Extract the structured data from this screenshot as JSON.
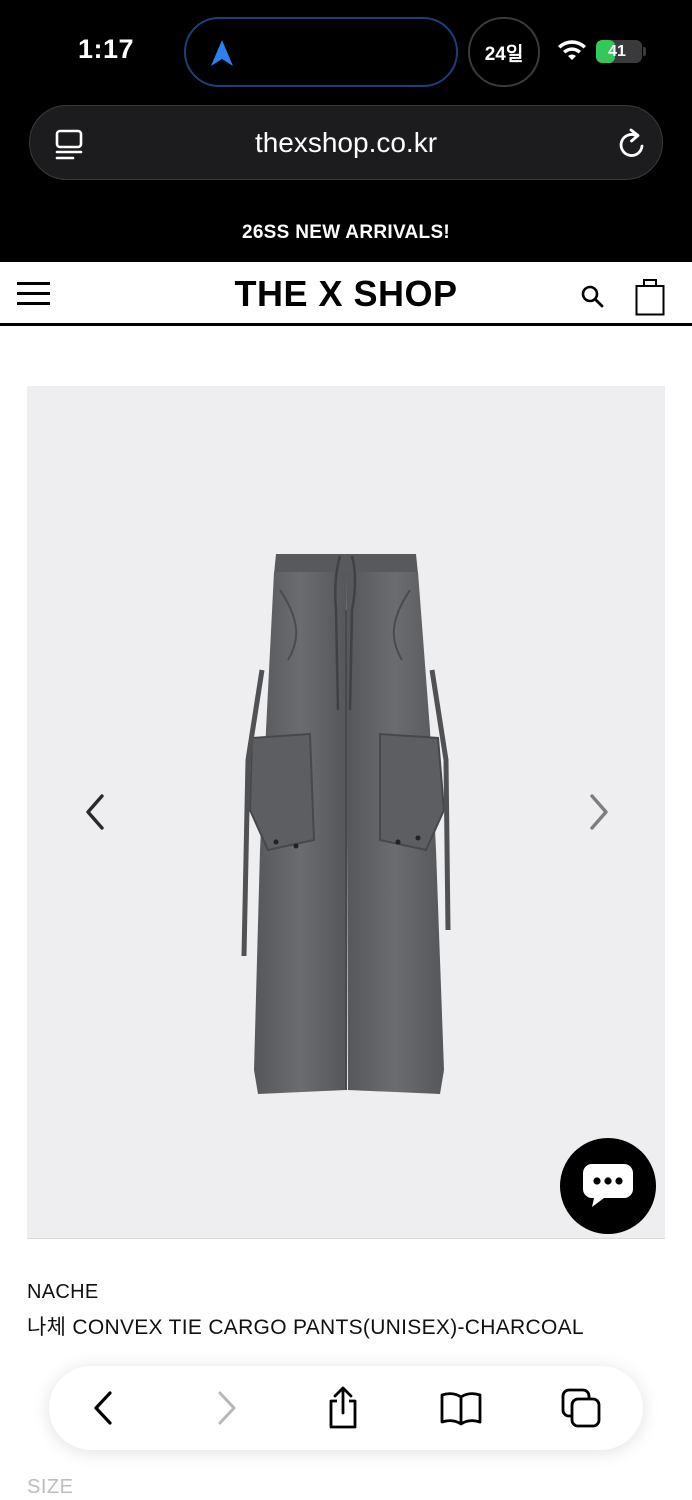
{
  "status_bar": {
    "time": "1:17",
    "date_pill": "24일",
    "battery_level": "41",
    "battery_fraction": 0.41,
    "accent_color": "#2f80ed"
  },
  "browser": {
    "url": "thexshop.co.kr"
  },
  "promo": {
    "text": "26SS NEW ARRIVALS!"
  },
  "site": {
    "logo": "THE X SHOP"
  },
  "product": {
    "brand": "NACHE",
    "name": "나체 CONVEX TIE CARGO PANTS(UNISEX)-CHARCOAL",
    "image_color": "#606266"
  },
  "options": {
    "size_label": "SIZE"
  },
  "icons": {
    "menu": "hamburger-menu-icon",
    "search": "search-icon",
    "bag": "shopping-bag-icon",
    "chat": "chat-bubble-icon",
    "back": "chevron-left-icon",
    "forward": "chevron-right-icon",
    "share": "share-icon",
    "bookmarks": "book-icon",
    "tabs": "tabs-icon"
  }
}
